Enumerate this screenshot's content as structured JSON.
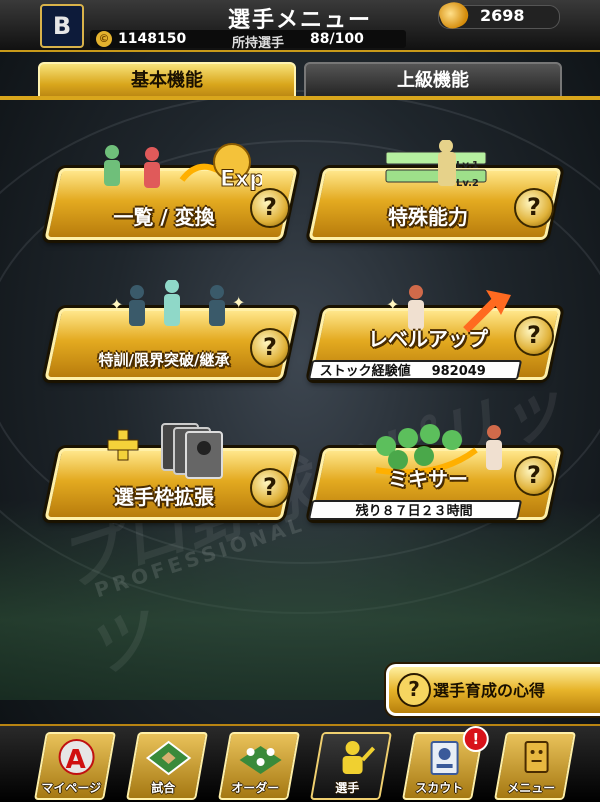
{
  "header": {
    "team_logo_letter": "B",
    "title": "選手メニュー",
    "gold_amount": "2698",
    "coin_symbol": "©",
    "coins": "1148150",
    "owned_players_label": "所持選手",
    "owned_players_value": "88/100"
  },
  "tabs": [
    {
      "label": "基本機能",
      "active": true
    },
    {
      "label": "上級機能",
      "active": false
    }
  ],
  "features": {
    "list_convert": {
      "label": "一覧 / 変換",
      "exp_text": "Exp",
      "help": "?"
    },
    "special_ability": {
      "label": "特殊能力",
      "lv1": "Lv.1",
      "lv2": "Lv.2",
      "help": "?"
    },
    "training": {
      "label": "特訓/限界突破/継承",
      "help": "?"
    },
    "level_up": {
      "label": "レベルアップ",
      "stock_label": "ストック経験値",
      "stock_value": "982049",
      "help": "?"
    },
    "slot_expand": {
      "label": "選手枠拡張",
      "help": "?"
    },
    "mixer": {
      "label": "ミキサー",
      "remaining": "残り８７日２３時間",
      "help": "?"
    }
  },
  "watermark": {
    "text": "プロ野球スピリッツ",
    "sub": "PROFESSIONAL"
  },
  "guide": {
    "icon": "?",
    "label": "選手育成の心得"
  },
  "bottom_nav": [
    {
      "label": "マイページ",
      "icon": "a-badge-icon",
      "active": false
    },
    {
      "label": "試合",
      "icon": "stadium-icon",
      "active": false
    },
    {
      "label": "オーダー",
      "icon": "lineup-icon",
      "active": false
    },
    {
      "label": "選手",
      "icon": "player-icon",
      "active": true
    },
    {
      "label": "スカウト",
      "icon": "scout-icon",
      "active": false,
      "badge": "!"
    },
    {
      "label": "メニュー",
      "icon": "menu-icon",
      "active": false
    }
  ],
  "colors": {
    "gold": "#e3aa20",
    "gold_light": "#ffe68a",
    "dark": "#111111",
    "badge_red": "#d8121a"
  }
}
